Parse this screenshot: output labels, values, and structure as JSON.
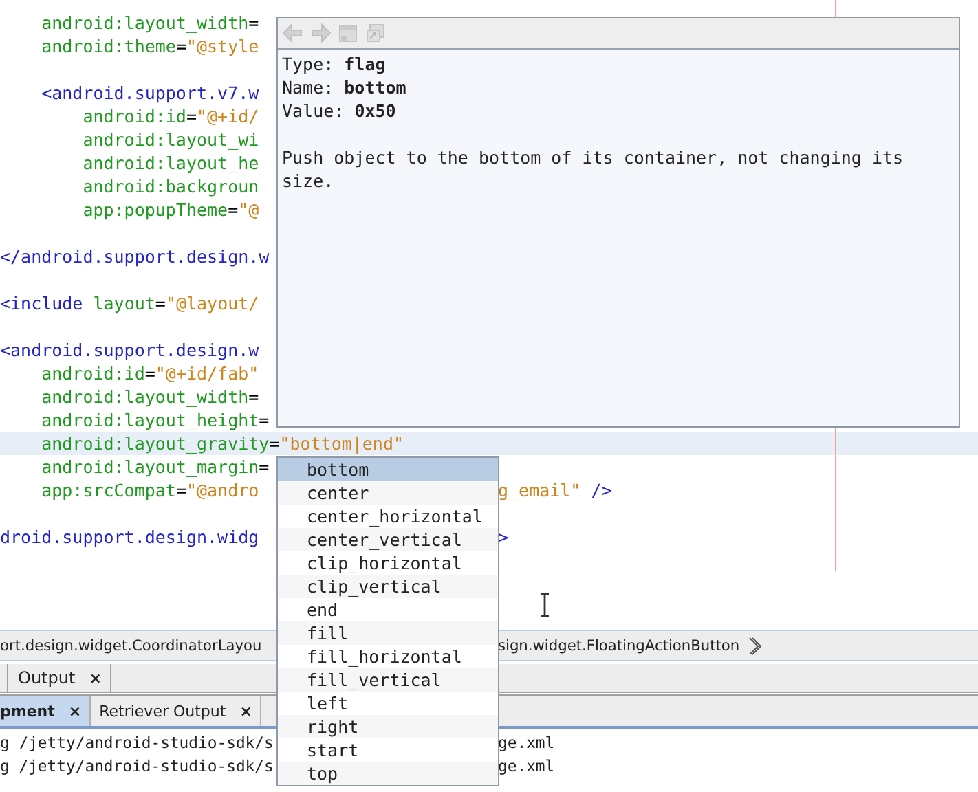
{
  "editor": {
    "lines": [
      {
        "kind": "code",
        "segments": [
          {
            "kind": "attr",
            "text": "    android:layout_width"
          },
          {
            "kind": "plain",
            "text": "="
          }
        ]
      },
      {
        "kind": "code",
        "segments": [
          {
            "kind": "attr",
            "text": "    android:theme"
          },
          {
            "kind": "plain",
            "text": "="
          },
          {
            "kind": "value",
            "text": "\"@style"
          }
        ]
      },
      {
        "kind": "blank"
      },
      {
        "kind": "code",
        "segments": [
          {
            "kind": "tag",
            "text": "    <android.support.v7.w"
          }
        ]
      },
      {
        "kind": "code",
        "segments": [
          {
            "kind": "attr",
            "text": "        android:id"
          },
          {
            "kind": "plain",
            "text": "="
          },
          {
            "kind": "value",
            "text": "\"@+id/"
          }
        ]
      },
      {
        "kind": "code",
        "segments": [
          {
            "kind": "attr",
            "text": "        android:layout_wi"
          }
        ]
      },
      {
        "kind": "code",
        "segments": [
          {
            "kind": "attr",
            "text": "        android:layout_he"
          }
        ]
      },
      {
        "kind": "code",
        "segments": [
          {
            "kind": "attr",
            "text": "        android:backgroun"
          }
        ]
      },
      {
        "kind": "code",
        "segments": [
          {
            "kind": "attr",
            "text": "        app:popupTheme"
          },
          {
            "kind": "plain",
            "text": "="
          },
          {
            "kind": "value",
            "text": "\"@"
          }
        ]
      },
      {
        "kind": "blank"
      },
      {
        "kind": "code",
        "segments": [
          {
            "kind": "tag",
            "text": "</android.support.design.w"
          }
        ]
      },
      {
        "kind": "blank"
      },
      {
        "kind": "code",
        "segments": [
          {
            "kind": "tag",
            "text": "<include"
          },
          {
            "kind": "attr",
            "text": " layout"
          },
          {
            "kind": "plain",
            "text": "="
          },
          {
            "kind": "value",
            "text": "\"@layout/"
          }
        ]
      },
      {
        "kind": "blank"
      },
      {
        "kind": "code",
        "segments": [
          {
            "kind": "tag",
            "text": "<android.support.design.w"
          }
        ]
      },
      {
        "kind": "code",
        "segments": [
          {
            "kind": "attr",
            "text": "    android:id"
          },
          {
            "kind": "plain",
            "text": "="
          },
          {
            "kind": "value",
            "text": "\"@+id/fab\""
          }
        ]
      },
      {
        "kind": "code",
        "segments": [
          {
            "kind": "attr",
            "text": "    android:layout_width"
          },
          {
            "kind": "plain",
            "text": "="
          }
        ]
      },
      {
        "kind": "code",
        "segments": [
          {
            "kind": "attr",
            "text": "    android:layout_height"
          },
          {
            "kind": "plain",
            "text": "="
          }
        ]
      },
      {
        "kind": "code",
        "current": true,
        "segments": [
          {
            "kind": "attr",
            "text": "    android:layout_gravity"
          },
          {
            "kind": "plain",
            "text": "="
          },
          {
            "kind": "value",
            "text": "\"bottom|end\""
          }
        ]
      },
      {
        "kind": "code",
        "segments": [
          {
            "kind": "attr",
            "text": "    android:layout_margin"
          },
          {
            "kind": "plain",
            "text": "="
          }
        ]
      },
      {
        "kind": "code",
        "segments": [
          {
            "kind": "attr",
            "text": "    app:srcCompat"
          },
          {
            "kind": "plain",
            "text": "="
          },
          {
            "kind": "value",
            "text": "\"@andro"
          }
        ],
        "tail": [
          {
            "kind": "value",
            "text": "g_email\""
          },
          {
            "kind": "tag",
            "text": " />"
          }
        ]
      },
      {
        "kind": "blank"
      },
      {
        "kind": "code",
        "segments": [
          {
            "kind": "tag",
            "text": "droid.support.design.widg"
          }
        ],
        "tail": [
          {
            "kind": "tag",
            "text": ">"
          }
        ]
      }
    ]
  },
  "doc_popup": {
    "toolbar": [
      {
        "kind": "back",
        "disabled": true
      },
      {
        "kind": "forward",
        "disabled": true
      },
      {
        "kind": "window",
        "disabled": true
      },
      {
        "kind": "external",
        "disabled": true
      }
    ],
    "fields": [
      {
        "label": "Type:",
        "value": "flag"
      },
      {
        "label": "Name:",
        "value": "bottom"
      },
      {
        "label": "Value:",
        "value": "0x50"
      }
    ],
    "description": "Push object to the bottom of its container, not changing its size."
  },
  "completion": {
    "items": [
      {
        "label": "bottom",
        "selected": true
      },
      {
        "label": "center",
        "selected": false
      },
      {
        "label": "center_horizontal",
        "selected": false
      },
      {
        "label": "center_vertical",
        "selected": false
      },
      {
        "label": "clip_horizontal",
        "selected": false
      },
      {
        "label": "clip_vertical",
        "selected": false
      },
      {
        "label": "end",
        "selected": false
      },
      {
        "label": "fill",
        "selected": false
      },
      {
        "label": "fill_horizontal",
        "selected": false
      },
      {
        "label": "fill_vertical",
        "selected": false
      },
      {
        "label": "left",
        "selected": false
      },
      {
        "label": "right",
        "selected": false
      },
      {
        "label": "start",
        "selected": false
      },
      {
        "label": "top",
        "selected": false
      }
    ]
  },
  "breadcrumbs": [
    "ort.design.widget.CoordinatorLayou",
    "sign.widget.FloatingActionButton"
  ],
  "panel_tabs": [
    {
      "label": "Output",
      "selected": false,
      "close": "×"
    }
  ],
  "output_tabs": [
    {
      "label": "pment",
      "selected": true,
      "close": "×"
    },
    {
      "label": "Retriever Output",
      "selected": false,
      "close": "×"
    }
  ],
  "output_lines": [
    {
      "text": "g /jetty/android-studio-sdk/s",
      "tail": "ge.xml"
    },
    {
      "text": "g /jetty/android-studio-sdk/s",
      "tail": "ge.xml"
    }
  ]
}
